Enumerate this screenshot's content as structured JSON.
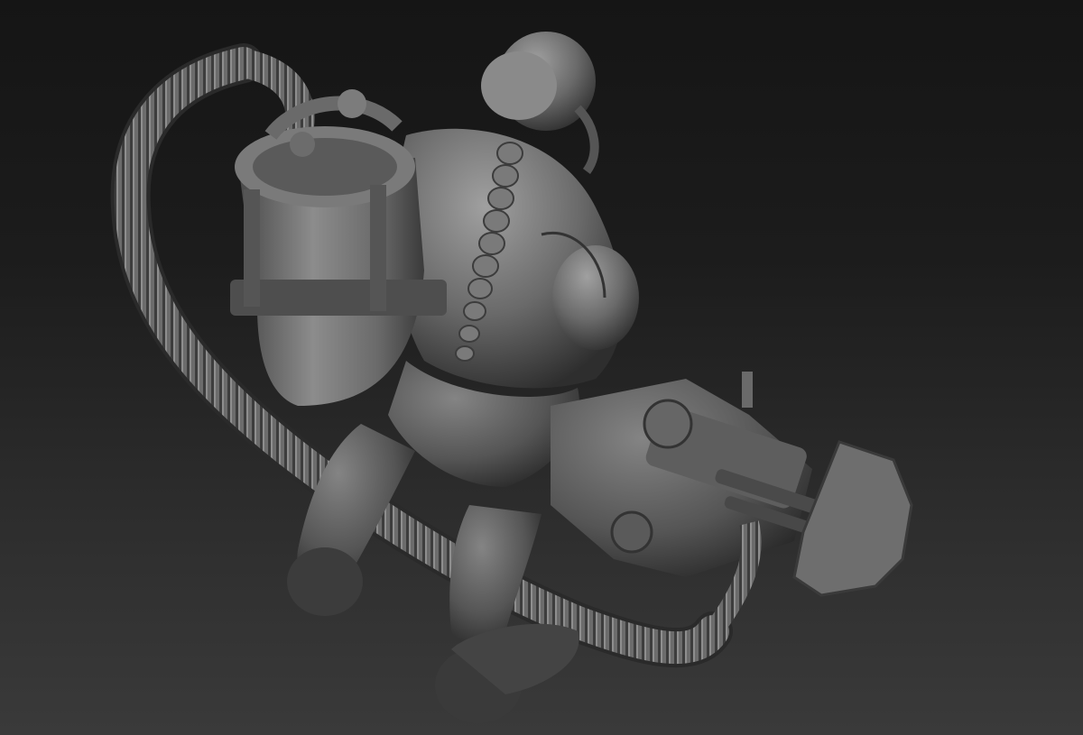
{
  "scene": {
    "subject": "sculpt-render",
    "colors": {
      "bg_top": "#151515",
      "bg_bottom": "#3a3a3a",
      "clay_light": "#9a9a9a",
      "clay_mid": "#6e6e6e",
      "clay_dark": "#3f3f3f",
      "clay_shadow": "#262626"
    }
  }
}
